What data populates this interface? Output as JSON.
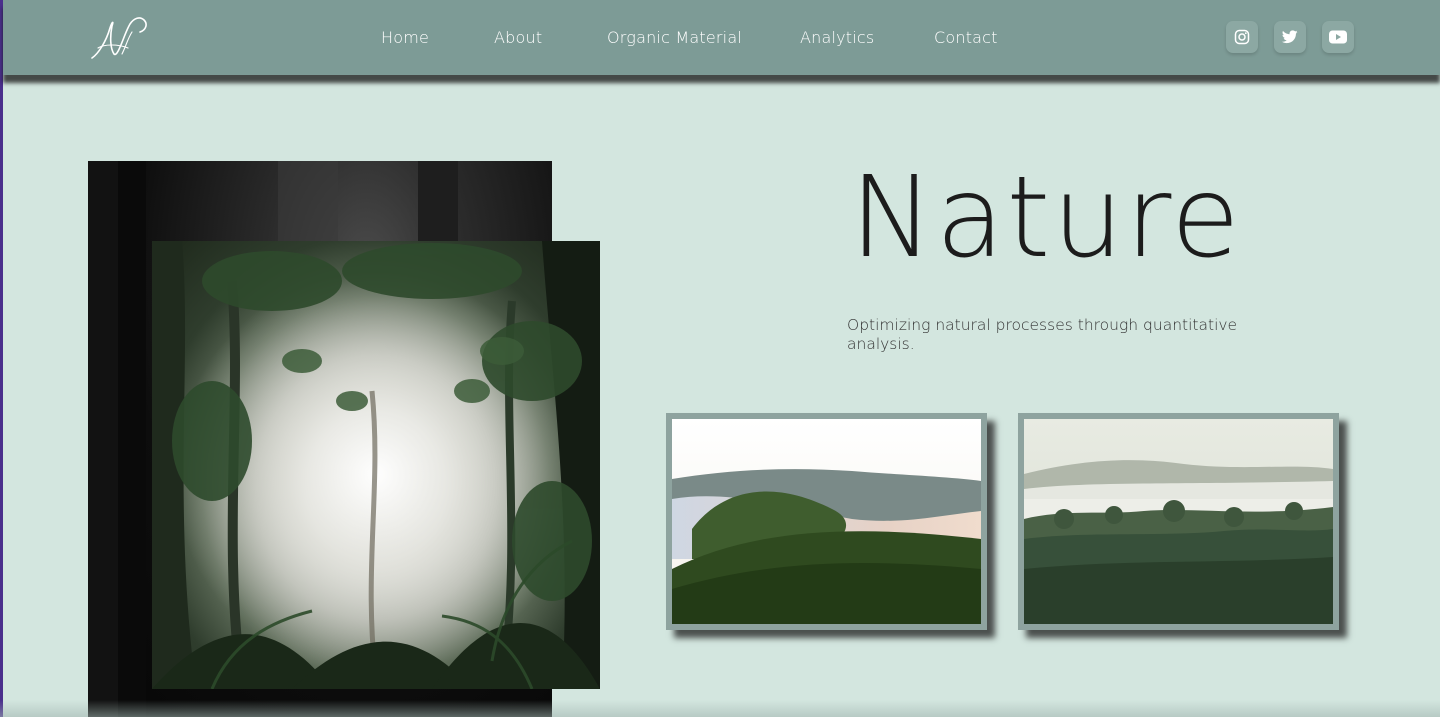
{
  "brand": {
    "logo_text": "N",
    "logo_icon": "script-n-logo"
  },
  "nav": {
    "items": [
      "Home",
      "About",
      "Organic Material",
      "Analytics",
      "Contact"
    ]
  },
  "social": [
    {
      "name": "instagram-icon"
    },
    {
      "name": "twitter-icon"
    },
    {
      "name": "youtube-icon"
    }
  ],
  "hero": {
    "title": "Nature",
    "subtitle": "Optimizing natural processes through quantitative analysis."
  },
  "colors": {
    "page_bg": "#d3e6df",
    "header_bg": "#7d9b96",
    "card_border": "#8ea39f",
    "text_dark": "#1c1c1c"
  },
  "images": {
    "collage": "misty-jungle-photo",
    "card_1": "foggy-hills-sunrise-photo",
    "card_2": "misty-forest-photo"
  }
}
